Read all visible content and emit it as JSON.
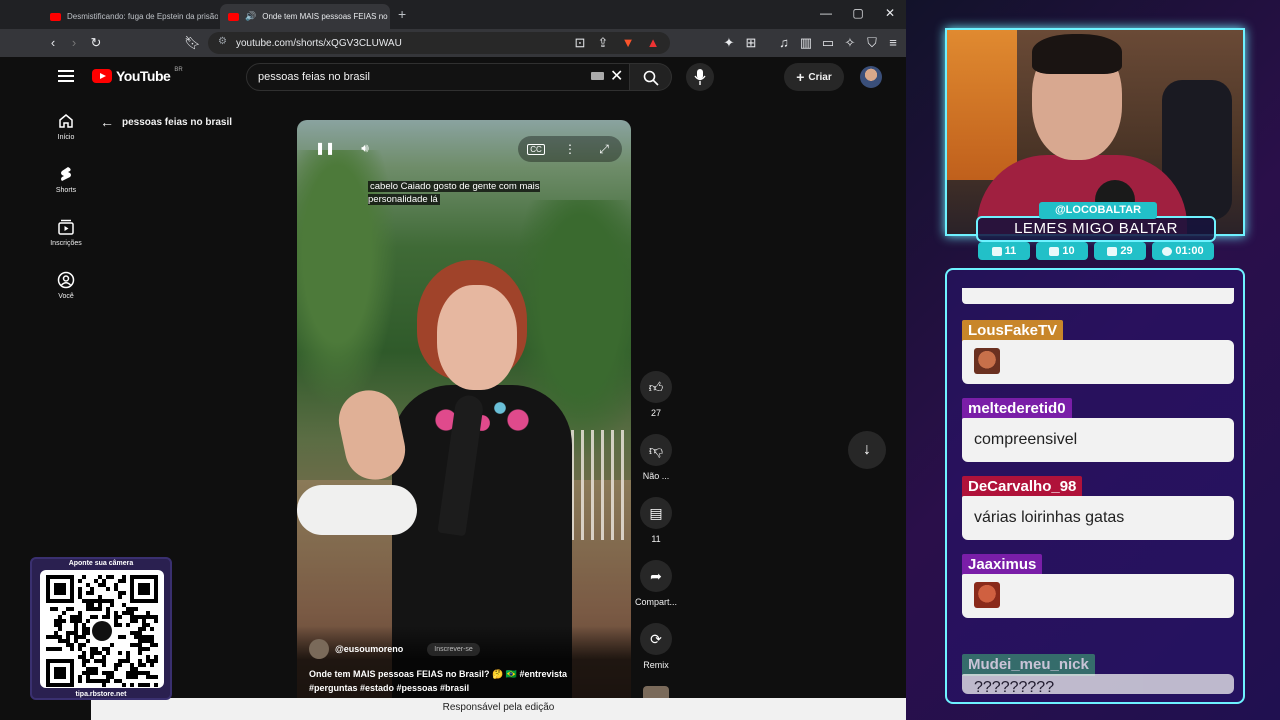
{
  "browser": {
    "tabs": [
      {
        "title": "Desmistificando: fuga de Epstein da prisão e",
        "active": false
      },
      {
        "title": "Onde tem MAIS pessoas FEIAS no",
        "active": true
      }
    ],
    "url": "youtube.com/shorts/xQGV3CLUWAU"
  },
  "youtube": {
    "logo_text": "YouTube",
    "country": "BR",
    "search_query": "pessoas feias no brasil",
    "create_label": "Criar",
    "nav": [
      {
        "label": "Início",
        "icon": "home-icon"
      },
      {
        "label": "Shorts",
        "icon": "shorts-icon"
      },
      {
        "label": "Inscrições",
        "icon": "subscriptions-icon"
      },
      {
        "label": "Você",
        "icon": "you-icon"
      }
    ],
    "back_label": "pessoas feias no brasil",
    "short": {
      "caption": "cabelo Caiado gosto de gente com mais personalidade lá",
      "channel": "@eusoumoreno",
      "subscribe": "Inscrever-se",
      "title": "Onde tem MAIS pessoas FEIAS no Brasil? 🤔 🇧🇷 #entrevista #perguntas #estado #pessoas #brasil"
    },
    "actions": [
      {
        "icon": "like-icon",
        "label": "27"
      },
      {
        "icon": "dislike-icon",
        "label": "Não ..."
      },
      {
        "icon": "comment-icon",
        "label": "11"
      },
      {
        "icon": "share-icon",
        "label": "Compart..."
      },
      {
        "icon": "remix-icon",
        "label": "Remix"
      }
    ]
  },
  "bottom_bar": "Responsável pela edição",
  "qr": {
    "top": "Aponte sua câmera",
    "bottom": "tipa.rbstore.net"
  },
  "stream": {
    "handle": "@LOCOBALTAR",
    "name": "LEMES MIGO BALTAR",
    "stats": [
      {
        "icon": "twitch-icon",
        "value": "11"
      },
      {
        "icon": "youtube-icon",
        "value": "10"
      },
      {
        "icon": "kick-icon",
        "value": "29"
      },
      {
        "icon": "clock-icon",
        "value": "01:00"
      }
    ],
    "chat": [
      {
        "user": "LousFakeTV",
        "color": "#c8862a",
        "message": "",
        "emote": true
      },
      {
        "user": "meltederetid0",
        "color": "#7a1ea8",
        "message": "compreensivel",
        "emote": false
      },
      {
        "user": "DeCarvalho_98",
        "color": "#b0123a",
        "message": "várias loirinhas gatas",
        "emote": false
      },
      {
        "user": "Jaaximus",
        "color": "#7a1ea8",
        "message": "",
        "emote": true
      },
      {
        "user": "Mudei_meu_nick",
        "color": "#3a8a70",
        "message": "?????????",
        "emote": false
      }
    ]
  },
  "colors": {
    "youtube_red": "#ff0000",
    "stream_accent": "#6ef2ff",
    "stream_badge": "#22c0c8"
  }
}
